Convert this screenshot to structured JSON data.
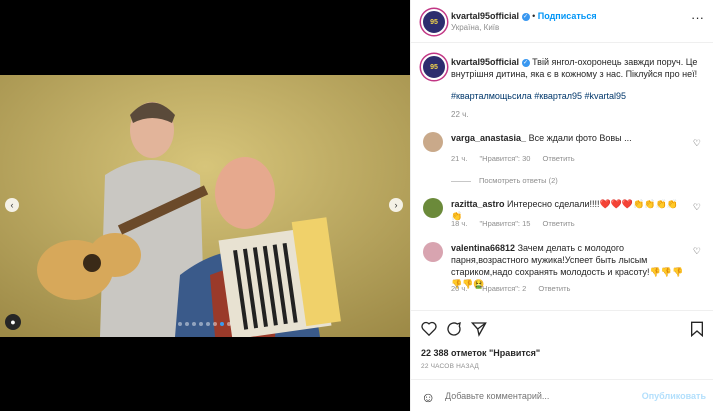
{
  "post": {
    "username": "kvartal95official",
    "follow_label": "Подписаться",
    "location": "Україна, Київ",
    "more_icon": "more-horizontal-icon",
    "avatar_text": "95",
    "caption": "Твій янгол-охоронець завжди поруч. Це внутрішня дитина, яка є в кожному з нас. Піклуйся про неї!",
    "hashtags": "#квартал95",
    "hashtag_all": "#кварталмощьсила #квартал95 #kvartal95",
    "caption_time": "22 ч."
  },
  "comments": [
    {
      "username": "varga_anastasia_",
      "text": "Все ждали фото Вовы ...",
      "time": "21 ч.",
      "likes": "\"Нравится\": 30",
      "reply": "Ответить",
      "avatar_color": "#c9a98a",
      "view_replies": "Посмотреть ответы (2)"
    },
    {
      "username": "razitta_astro",
      "text": "Интересно сделали!!!!❤️❤️❤️👏👏👏👏👏",
      "time": "18 ч.",
      "likes": "\"Нравится\": 15",
      "reply": "Ответить",
      "avatar_color": "#6b8a3a"
    },
    {
      "username": "valentina66812",
      "text": "Зачем делать с молодого парня,возрастного мужика!Успеет быть лысым стариком,надо сохранять молодость и красоту!👎👎👎👎👎🤮",
      "time": "20 ч.",
      "likes": "\"Нравится\": 2",
      "reply": "Ответить",
      "avatar_color": "#d8a4b0"
    }
  ],
  "actions": {
    "like_icon": "heart-icon",
    "comment_icon": "comment-icon",
    "share_icon": "share-icon",
    "save_icon": "bookmark-icon",
    "likes_count": "22 388 отметок \"Нравится\"",
    "timestamp": "22 ЧАСОВ НАЗАД",
    "comment_placeholder": "Добавьте комментарий...",
    "publish_label": "Опубликовать"
  },
  "carousel": {
    "dots_total": 8,
    "active_dot": 6
  }
}
